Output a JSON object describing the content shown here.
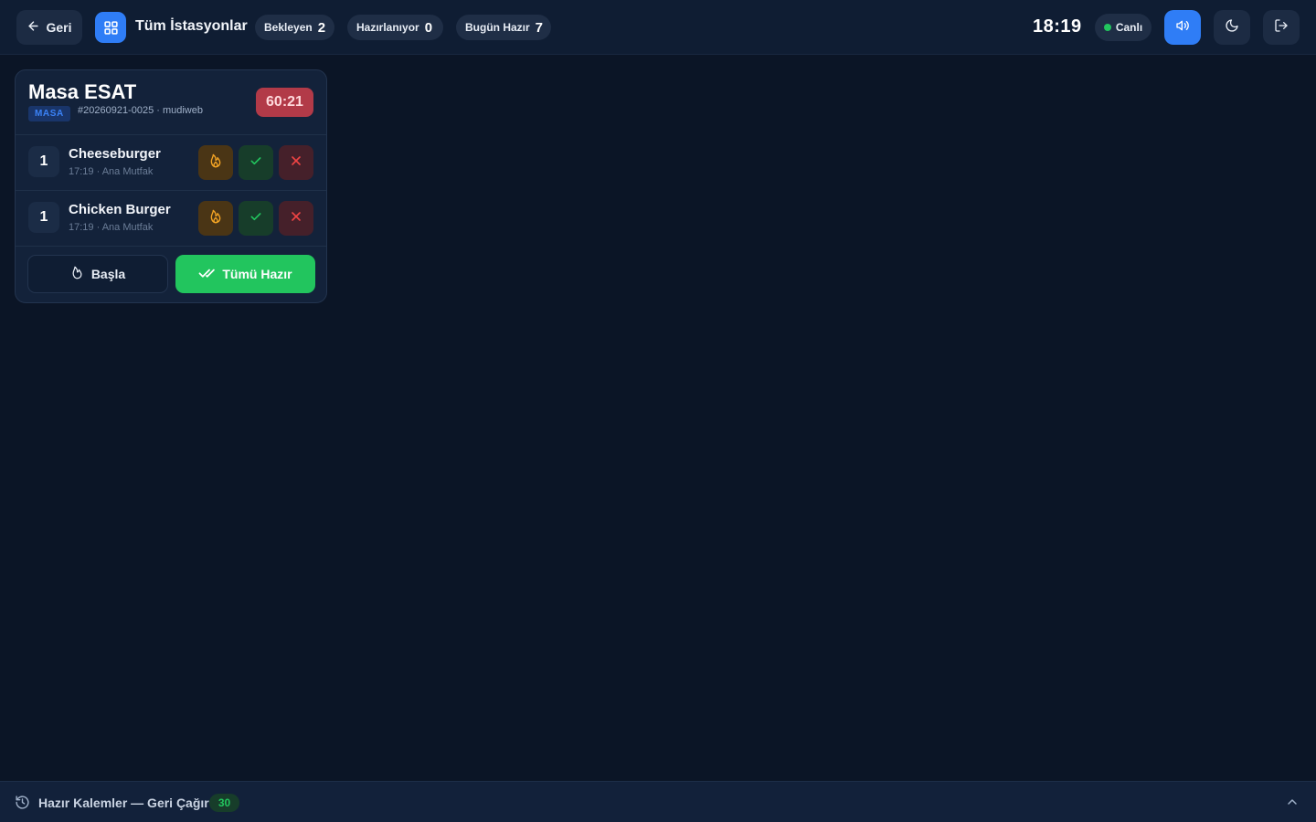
{
  "header": {
    "back_label": "Geri",
    "station_title": "Tüm İstasyonlar",
    "stats": [
      {
        "label": "Bekleyen",
        "value": "2"
      },
      {
        "label": "Hazırlanıyor",
        "value": "0"
      },
      {
        "label": "Bugün Hazır",
        "value": "7"
      }
    ],
    "clock": "18:19",
    "live_label": "Canlı",
    "icons": {
      "back": "arrow-left-icon",
      "station": "grid-icon",
      "sound": "speaker-icon",
      "theme": "moon-icon",
      "logout": "logout-icon"
    }
  },
  "order": {
    "table_name": "Masa ESAT",
    "type_badge": "MASA",
    "meta": "#20260921-0025  · mudiweb",
    "timer": "60:21",
    "items": [
      {
        "qty": "1",
        "name": "Cheeseburger",
        "sub": "17:19 · Ana Mutfak"
      },
      {
        "qty": "1",
        "name": "Chicken Burger",
        "sub": "17:19 · Ana Mutfak"
      }
    ],
    "start_all_label": "Başla",
    "all_ready_label": "Tümü Hazır"
  },
  "recall": {
    "label": "Hazır Kalemler — Geri Çağır",
    "count": "30"
  },
  "colors": {
    "background": "#0b1526",
    "accent_blue": "#2f7df6",
    "ready_green": "#22c55e",
    "timer_red": "#b23a48",
    "flame_amber": "#f5a524",
    "cancel_red": "#ef4444"
  }
}
